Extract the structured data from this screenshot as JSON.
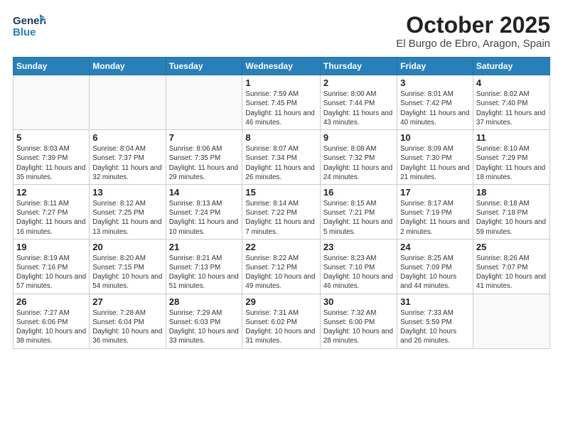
{
  "header": {
    "logo_line1": "General",
    "logo_line2": "Blue",
    "title": "October 2025",
    "subtitle": "El Burgo de Ebro, Aragon, Spain"
  },
  "days_of_week": [
    "Sunday",
    "Monday",
    "Tuesday",
    "Wednesday",
    "Thursday",
    "Friday",
    "Saturday"
  ],
  "weeks": [
    [
      {
        "day": "",
        "info": ""
      },
      {
        "day": "",
        "info": ""
      },
      {
        "day": "",
        "info": ""
      },
      {
        "day": "1",
        "info": "Sunrise: 7:59 AM\nSunset: 7:45 PM\nDaylight: 11 hours and 46 minutes."
      },
      {
        "day": "2",
        "info": "Sunrise: 8:00 AM\nSunset: 7:44 PM\nDaylight: 11 hours and 43 minutes."
      },
      {
        "day": "3",
        "info": "Sunrise: 8:01 AM\nSunset: 7:42 PM\nDaylight: 11 hours and 40 minutes."
      },
      {
        "day": "4",
        "info": "Sunrise: 8:02 AM\nSunset: 7:40 PM\nDaylight: 11 hours and 37 minutes."
      }
    ],
    [
      {
        "day": "5",
        "info": "Sunrise: 8:03 AM\nSunset: 7:39 PM\nDaylight: 11 hours and 35 minutes."
      },
      {
        "day": "6",
        "info": "Sunrise: 8:04 AM\nSunset: 7:37 PM\nDaylight: 11 hours and 32 minutes."
      },
      {
        "day": "7",
        "info": "Sunrise: 8:06 AM\nSunset: 7:35 PM\nDaylight: 11 hours and 29 minutes."
      },
      {
        "day": "8",
        "info": "Sunrise: 8:07 AM\nSunset: 7:34 PM\nDaylight: 11 hours and 26 minutes."
      },
      {
        "day": "9",
        "info": "Sunrise: 8:08 AM\nSunset: 7:32 PM\nDaylight: 11 hours and 24 minutes."
      },
      {
        "day": "10",
        "info": "Sunrise: 8:09 AM\nSunset: 7:30 PM\nDaylight: 11 hours and 21 minutes."
      },
      {
        "day": "11",
        "info": "Sunrise: 8:10 AM\nSunset: 7:29 PM\nDaylight: 11 hours and 18 minutes."
      }
    ],
    [
      {
        "day": "12",
        "info": "Sunrise: 8:11 AM\nSunset: 7:27 PM\nDaylight: 11 hours and 16 minutes."
      },
      {
        "day": "13",
        "info": "Sunrise: 8:12 AM\nSunset: 7:25 PM\nDaylight: 11 hours and 13 minutes."
      },
      {
        "day": "14",
        "info": "Sunrise: 8:13 AM\nSunset: 7:24 PM\nDaylight: 11 hours and 10 minutes."
      },
      {
        "day": "15",
        "info": "Sunrise: 8:14 AM\nSunset: 7:22 PM\nDaylight: 11 hours and 7 minutes."
      },
      {
        "day": "16",
        "info": "Sunrise: 8:15 AM\nSunset: 7:21 PM\nDaylight: 11 hours and 5 minutes."
      },
      {
        "day": "17",
        "info": "Sunrise: 8:17 AM\nSunset: 7:19 PM\nDaylight: 11 hours and 2 minutes."
      },
      {
        "day": "18",
        "info": "Sunrise: 8:18 AM\nSunset: 7:18 PM\nDaylight: 10 hours and 59 minutes."
      }
    ],
    [
      {
        "day": "19",
        "info": "Sunrise: 8:19 AM\nSunset: 7:16 PM\nDaylight: 10 hours and 57 minutes."
      },
      {
        "day": "20",
        "info": "Sunrise: 8:20 AM\nSunset: 7:15 PM\nDaylight: 10 hours and 54 minutes."
      },
      {
        "day": "21",
        "info": "Sunrise: 8:21 AM\nSunset: 7:13 PM\nDaylight: 10 hours and 51 minutes."
      },
      {
        "day": "22",
        "info": "Sunrise: 8:22 AM\nSunset: 7:12 PM\nDaylight: 10 hours and 49 minutes."
      },
      {
        "day": "23",
        "info": "Sunrise: 8:23 AM\nSunset: 7:10 PM\nDaylight: 10 hours and 46 minutes."
      },
      {
        "day": "24",
        "info": "Sunrise: 8:25 AM\nSunset: 7:09 PM\nDaylight: 10 hours and 44 minutes."
      },
      {
        "day": "25",
        "info": "Sunrise: 8:26 AM\nSunset: 7:07 PM\nDaylight: 10 hours and 41 minutes."
      }
    ],
    [
      {
        "day": "26",
        "info": "Sunrise: 7:27 AM\nSunset: 6:06 PM\nDaylight: 10 hours and 38 minutes."
      },
      {
        "day": "27",
        "info": "Sunrise: 7:28 AM\nSunset: 6:04 PM\nDaylight: 10 hours and 36 minutes."
      },
      {
        "day": "28",
        "info": "Sunrise: 7:29 AM\nSunset: 6:03 PM\nDaylight: 10 hours and 33 minutes."
      },
      {
        "day": "29",
        "info": "Sunrise: 7:31 AM\nSunset: 6:02 PM\nDaylight: 10 hours and 31 minutes."
      },
      {
        "day": "30",
        "info": "Sunrise: 7:32 AM\nSunset: 6:00 PM\nDaylight: 10 hours and 28 minutes."
      },
      {
        "day": "31",
        "info": "Sunrise: 7:33 AM\nSunset: 5:59 PM\nDaylight: 10 hours and 26 minutes."
      },
      {
        "day": "",
        "info": ""
      }
    ]
  ]
}
